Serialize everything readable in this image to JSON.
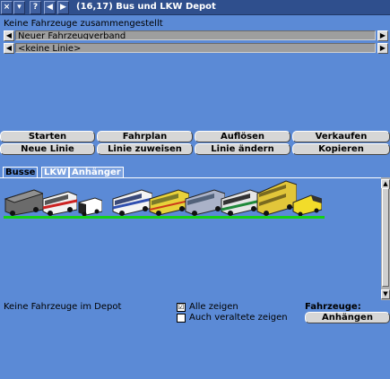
{
  "window": {
    "title": "(16,17) Bus und LKW Depot",
    "buttons": {
      "close": "×",
      "menu": "▾",
      "help": "?",
      "prev": "◀",
      "next": "▶"
    }
  },
  "status": "Keine Fahrzeuge zusammengestellt",
  "convoy_select": {
    "value": "Neuer Fahrzeugverband"
  },
  "line_select": {
    "value": "<keine Linie>"
  },
  "buttons": {
    "start": "Starten",
    "schedule": "Fahrplan",
    "dissolve": "Auflösen",
    "sell": "Verkaufen",
    "new_line": "Neue Linie",
    "assign_line": "Linie zuweisen",
    "change_line": "Linie ändern",
    "copy": "Kopieren",
    "append": "Anhängen"
  },
  "tabs": [
    "Busse",
    "LKW",
    "Anhänger"
  ],
  "vehicles": [
    {
      "name": "bus-dark",
      "color": "#6b6b6b",
      "accent": "#444444"
    },
    {
      "name": "bus-white-red",
      "color": "#f2f2f2",
      "accent": "#cc2222"
    },
    {
      "name": "bus-small-white",
      "color": "#ffffff",
      "accent": "#222222"
    },
    {
      "name": "bus-white-blue",
      "color": "#f4f4f4",
      "accent": "#2f4fb0"
    },
    {
      "name": "bus-yellow",
      "color": "#e8d23a",
      "accent": "#7a7a2a"
    },
    {
      "name": "bus-grey-blue",
      "color": "#aab2c8",
      "accent": "#52627a"
    },
    {
      "name": "bus-green-white",
      "color": "#e6e6e6",
      "accent": "#1f8a3a"
    },
    {
      "name": "bus-double-yellow",
      "color": "#e2c63a",
      "accent": "#7a6a20"
    },
    {
      "name": "minibus-yellow",
      "color": "#f2dc2a",
      "accent": "#333333"
    }
  ],
  "depot_status": "Keine Fahrzeuge im Depot",
  "options": {
    "show_all": {
      "label": "Alle zeigen",
      "checked": "☑"
    },
    "show_obsolete": {
      "label": "Auch veraltete zeigen",
      "checked": ""
    }
  },
  "vehicles_label": "Fahrzeuge:"
}
